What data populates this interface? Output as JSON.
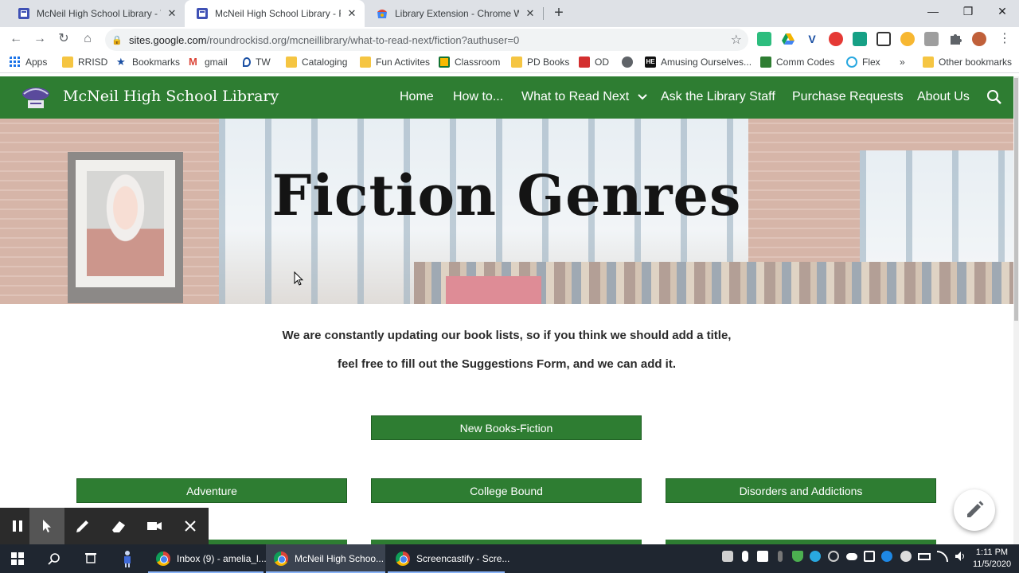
{
  "browser": {
    "tabs": [
      {
        "title": "McNeil High School Library - Wh",
        "active": false
      },
      {
        "title": "McNeil High School Library - Fict",
        "active": true
      },
      {
        "title": "Library Extension - Chrome Web",
        "active": false
      }
    ],
    "new_tab": "+",
    "window_controls": {
      "minimize": "—",
      "restore": "❐",
      "close": "✕"
    },
    "nav": {
      "back": "←",
      "forward": "→",
      "reload": "↻",
      "home": "⌂"
    },
    "url_host": "sites.google.com",
    "url_path": "/roundrockisd.org/mcneillibrary/what-to-read-next/fiction?authuser=0",
    "lock_icon": "🔒",
    "star_icon": "☆",
    "bookmarks": [
      {
        "label": "Apps",
        "icon": "apps-grid"
      },
      {
        "label": "RRISD",
        "icon": "folder"
      },
      {
        "label": "Bookmarks",
        "icon": "star"
      },
      {
        "label": "gmail",
        "icon": "gmail"
      },
      {
        "label": "TW",
        "icon": "tw"
      },
      {
        "label": "Cataloging",
        "icon": "folder"
      },
      {
        "label": "Fun Activites",
        "icon": "folder"
      },
      {
        "label": "Classroom",
        "icon": "classroom"
      },
      {
        "label": "PD Books",
        "icon": "folder"
      },
      {
        "label": "OD",
        "icon": "od"
      },
      {
        "label": "",
        "icon": "globe"
      },
      {
        "label": "Amusing Ourselves...",
        "icon": "he"
      },
      {
        "label": "Comm Codes",
        "icon": "comm"
      },
      {
        "label": "Flex",
        "icon": "flex"
      },
      {
        "label": "»",
        "icon": ""
      },
      {
        "label": "Other bookmarks",
        "icon": "folder"
      }
    ]
  },
  "site": {
    "name": "McNeil High School Library",
    "nav": [
      "Home",
      "How to...",
      "What to Read Next",
      "Ask the Library Staff",
      "Purchase Requests",
      "About Us"
    ],
    "dropdown_glyph": "⌄"
  },
  "hero": {
    "title": "Fiction Genres"
  },
  "intro": {
    "line1": "We are constantly updating our book lists, so if you think we should add a title,",
    "line2": "feel free to fill out the Suggestions Form, and we can add it."
  },
  "buttons": {
    "new_books": "New Books-Fiction",
    "genres": [
      "Adventure",
      "College Bound",
      "Disorders and Addictions"
    ]
  },
  "colors": {
    "brand_green": "#2e7d32",
    "taskbar": "#1f2630"
  },
  "taskbar": {
    "items": [
      {
        "label": "Inbox (9) - amelia_l...",
        "active": false
      },
      {
        "label": "McNeil High Schoo...",
        "active": true
      },
      {
        "label": "Screencastify - Scre...",
        "active": false
      }
    ],
    "time": "1:11 PM",
    "date": "11/5/2020"
  }
}
